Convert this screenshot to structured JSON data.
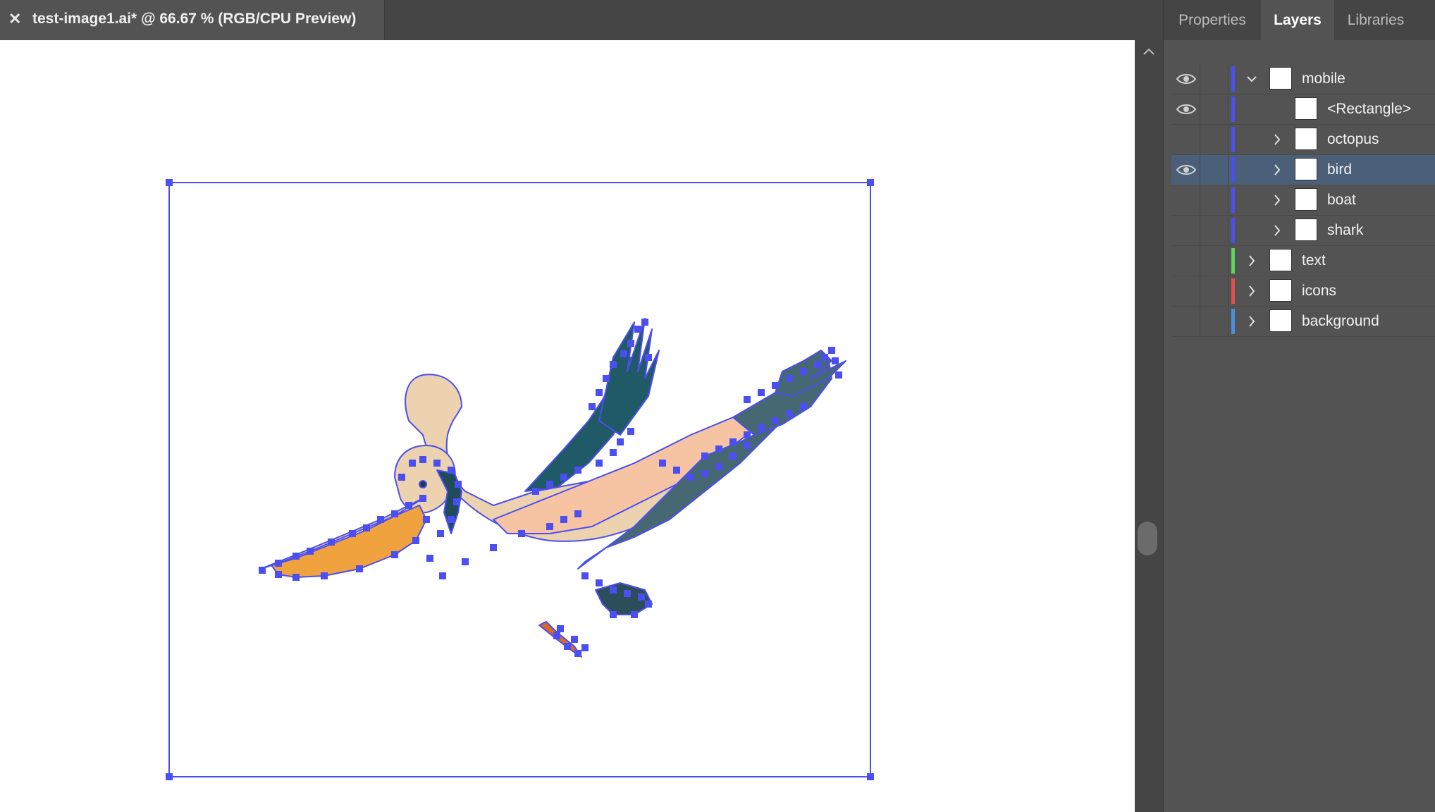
{
  "document": {
    "title": "test-image1.ai* @ 66.67 % (RGB/CPU Preview)",
    "close_glyph": "✕"
  },
  "panel": {
    "tabs": [
      {
        "label": "Properties",
        "active": false
      },
      {
        "label": "Layers",
        "active": true
      },
      {
        "label": "Libraries",
        "active": false
      }
    ]
  },
  "layers": [
    {
      "name": "mobile",
      "visible": true,
      "color": "#4b4ef0",
      "expanded": true,
      "level": 0,
      "selected": false
    },
    {
      "name": "<Rectangle>",
      "visible": true,
      "color": "#4b4ef0",
      "level": 1,
      "selected": false
    },
    {
      "name": "octopus",
      "visible": false,
      "color": "#4b4ef0",
      "expanded": false,
      "level": 1,
      "selected": false
    },
    {
      "name": "bird",
      "visible": true,
      "color": "#4b4ef0",
      "expanded": false,
      "level": 1,
      "selected": true
    },
    {
      "name": "boat",
      "visible": false,
      "color": "#4b4ef0",
      "expanded": false,
      "level": 1,
      "selected": false
    },
    {
      "name": "shark",
      "visible": false,
      "color": "#4b4ef0",
      "expanded": false,
      "level": 1,
      "selected": false
    },
    {
      "name": "text",
      "visible": false,
      "color": "#5cd65c",
      "expanded": false,
      "level": 0,
      "selected": false
    },
    {
      "name": "icons",
      "visible": false,
      "color": "#e05050",
      "expanded": false,
      "level": 0,
      "selected": false
    },
    {
      "name": "background",
      "visible": false,
      "color": "#4a8fe0",
      "expanded": false,
      "level": 0,
      "selected": false
    }
  ],
  "colors": {
    "selection": "#4b4ef0",
    "panel_bg": "#535353",
    "selected_row": "#4b5f78"
  },
  "icons": {
    "visibility": "eye-icon",
    "expand": "chevron-right-icon",
    "collapse": "chevron-down-icon",
    "scroll_up": "chevron-up-icon"
  }
}
